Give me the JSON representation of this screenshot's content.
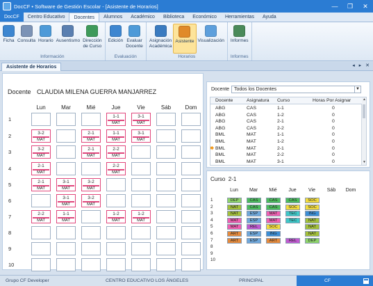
{
  "window": {
    "title": "DocCF • Software de Gestión Escolar - [Asistente de Horarios]",
    "controls": [
      "—",
      "❐",
      "✕"
    ]
  },
  "ribbon_tabs": [
    "DocCF",
    "Centro Educativo",
    "Docentes",
    "Alumnos",
    "Académico",
    "Biblioteca",
    "Económico",
    "Herramientas",
    "Ayuda"
  ],
  "ribbon_groups": [
    {
      "label": "Información",
      "buttons": [
        {
          "label": "Ficha",
          "icon": "id-card-icon"
        },
        {
          "label": "Consulta",
          "icon": "magnifier-icon"
        },
        {
          "label": "Horario",
          "icon": "clock-icon"
        },
        {
          "label": "Ausentismo",
          "icon": "person-absence-icon"
        },
        {
          "label": "Dirección\nde Curso",
          "icon": "person-board-icon"
        }
      ]
    },
    {
      "label": "Evaluación",
      "buttons": [
        {
          "label": "Edición",
          "icon": "edit-list-icon"
        },
        {
          "label": "Evaluar\nDocente",
          "icon": "evaluate-icon"
        }
      ]
    },
    {
      "label": "Horarios",
      "buttons": [
        {
          "label": "Asignación\nAcadémica",
          "icon": "assignment-icon"
        },
        {
          "label": "Asistente",
          "icon": "wizard-icon",
          "active": true
        },
        {
          "label": "Visualización",
          "icon": "view-schedule-icon"
        }
      ]
    },
    {
      "label": "Informes",
      "buttons": [
        {
          "label": "Informes",
          "icon": "report-icon"
        }
      ]
    }
  ],
  "doc_tab": "Asistente de Horarios",
  "doc_nav": "◂ ▸ ✕",
  "schedule": {
    "teacher_label": "Docente",
    "teacher_name": "CLAUDIA MILENA GUERRA MANJARREZ",
    "days": [
      "Lun",
      "Mar",
      "Mié",
      "Jue",
      "Vie",
      "Sáb",
      "Dom"
    ],
    "periods": [
      "1",
      "2",
      "3",
      "4",
      "5",
      "6",
      "7",
      "8",
      "9",
      "10"
    ],
    "slots": [
      {
        "row": 0,
        "col": 3,
        "code": "1-1",
        "subject": "MAT"
      },
      {
        "row": 0,
        "col": 4,
        "code": "3-1",
        "subject": "MAT"
      },
      {
        "row": 1,
        "col": 0,
        "code": "3-2",
        "subject": "MAT"
      },
      {
        "row": 1,
        "col": 2,
        "code": "2-1",
        "subject": "MAT"
      },
      {
        "row": 1,
        "col": 3,
        "code": "1-1",
        "subject": "MAT"
      },
      {
        "row": 1,
        "col": 4,
        "code": "3-1",
        "subject": "MAT"
      },
      {
        "row": 2,
        "col": 0,
        "code": "3-2",
        "subject": "MAT"
      },
      {
        "row": 2,
        "col": 2,
        "code": "2-1",
        "subject": "MAT"
      },
      {
        "row": 2,
        "col": 3,
        "code": "2-2",
        "subject": "MAT"
      },
      {
        "row": 3,
        "col": 0,
        "code": "2-1",
        "subject": "MAT"
      },
      {
        "row": 3,
        "col": 3,
        "code": "2-2",
        "subject": "MAT"
      },
      {
        "row": 4,
        "col": 0,
        "code": "2-1",
        "subject": "MAT"
      },
      {
        "row": 4,
        "col": 1,
        "code": "3-1",
        "subject": "MAT"
      },
      {
        "row": 4,
        "col": 2,
        "code": "3-2",
        "subject": "MAT"
      },
      {
        "row": 5,
        "col": 1,
        "code": "3-1",
        "subject": "MAT"
      },
      {
        "row": 5,
        "col": 2,
        "code": "3-2",
        "subject": "MAT"
      },
      {
        "row": 6,
        "col": 0,
        "code": "2-2",
        "subject": "MAT"
      },
      {
        "row": 6,
        "col": 1,
        "code": "1-1",
        "subject": "MAT"
      },
      {
        "row": 6,
        "col": 3,
        "code": "1-2",
        "subject": "MAT"
      },
      {
        "row": 6,
        "col": 4,
        "code": "1-2",
        "subject": "MAT"
      }
    ]
  },
  "filter": {
    "label": "Docente",
    "value": "Todos los Docentes"
  },
  "assign_table": {
    "headers": [
      "Docente",
      "Asignatura",
      "Curso",
      "Horas Por Asignar"
    ],
    "rows": [
      [
        "ABG",
        "CAS",
        "1-1",
        "0"
      ],
      [
        "ABG",
        "CAS",
        "1-2",
        "0"
      ],
      [
        "ABG",
        "CAS",
        "2-1",
        "0"
      ],
      [
        "ABG",
        "CAS",
        "2-2",
        "0"
      ],
      [
        "BML",
        "MAT",
        "1-1",
        "0"
      ],
      [
        "BML",
        "MAT",
        "1-2",
        "0"
      ],
      [
        "BML",
        "MAT",
        "2-1",
        "0"
      ],
      [
        "BML",
        "MAT",
        "2-2",
        "0"
      ],
      [
        "BML",
        "MAT",
        "3-1",
        "0"
      ]
    ],
    "current_row": 6
  },
  "course": {
    "title": "Curso",
    "code": "2-1",
    "days": [
      "Lun",
      "Mar",
      "Mié",
      "Jue",
      "Vie",
      "Sáb",
      "Dom"
    ],
    "periods": [
      "1",
      "2",
      "3",
      "4",
      "5",
      "6",
      "7",
      "8",
      "9",
      "10"
    ],
    "colors": {
      "DEP": "#8ed36a",
      "CAS": "#4cbd5d",
      "SOC": "#f3dc3e",
      "NAT": "#a3bf3a",
      "MAT": "#ef5fb1",
      "TEC": "#3ec8c8",
      "ING": "#3b8ed6",
      "ESP": "#6fa8dc",
      "ART": "#e58a3c",
      "REL": "#c05ad0"
    },
    "grid": [
      [
        "DEP",
        "CAS",
        "CAS",
        "CAS",
        "SOC"
      ],
      [
        "NAT",
        "CAS",
        "CAS",
        "SOC",
        "SOC"
      ],
      [
        "NAT",
        "ESP",
        "MAT",
        "TEC",
        "ING"
      ],
      [
        "MAT",
        "ESP",
        "MAT",
        "TEC",
        "NAT"
      ],
      [
        "MAT",
        "REL",
        "SOC",
        "",
        "NAT"
      ],
      [
        "ART",
        "ESP",
        "ING",
        "",
        "NAT"
      ],
      [
        "ART",
        "ESP",
        "ART",
        "REL",
        "DEP"
      ]
    ]
  },
  "status": {
    "left": "Grupo CF Developer",
    "center": "CENTRO EDUCATIVO LOS ÁNGELES",
    "right": "PRINCIPAL",
    "badge": "CF"
  }
}
